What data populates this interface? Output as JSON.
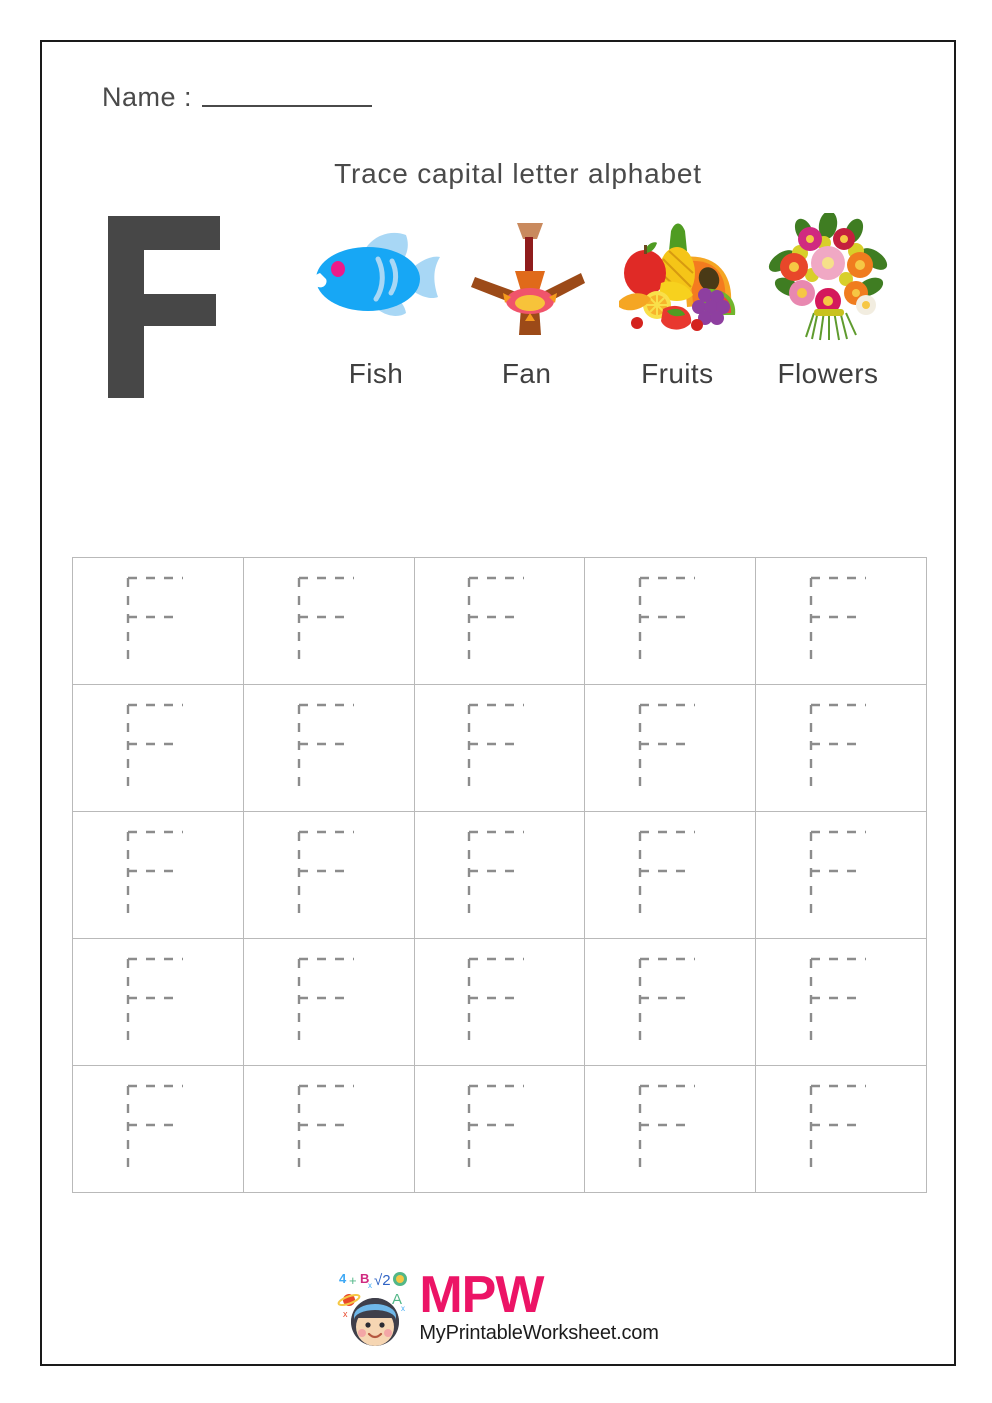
{
  "page": {
    "name_label": "Name :",
    "title": "Trace capital letter alphabet",
    "letter": "F",
    "letter_color": "#474747",
    "border_color": "#1a1a1a",
    "text_color": "#4a4a4a"
  },
  "pictures": [
    {
      "label": "Fish",
      "icon": "fish-illustration",
      "colors": [
        "#17a7f5",
        "#a8d7f5",
        "#ec1a8a"
      ]
    },
    {
      "label": "Fan",
      "icon": "ceiling-fan-illustration",
      "colors": [
        "#9c4a18",
        "#e06a1a",
        "#8f1c1c",
        "#f0546b"
      ]
    },
    {
      "label": "Fruits",
      "icon": "fruits-illustration",
      "colors": [
        "#e02a26",
        "#f5c518",
        "#71b52c",
        "#8e3fa0"
      ]
    },
    {
      "label": "Flowers",
      "icon": "flower-bouquet-illustration",
      "colors": [
        "#e8487e",
        "#f07c1e",
        "#d92a2a",
        "#4d8c2a"
      ]
    }
  ],
  "trace_grid": {
    "rows": 5,
    "columns": 5,
    "cell_count": 25,
    "trace_letter": "F",
    "dash_color": "#8c8c8c",
    "grid_line_color": "#b9b9b9",
    "cells": [
      "F",
      "F",
      "F",
      "F",
      "F",
      "F",
      "F",
      "F",
      "F",
      "F",
      "F",
      "F",
      "F",
      "F",
      "F",
      "F",
      "F",
      "F",
      "F",
      "F",
      "F",
      "F",
      "F",
      "F",
      "F"
    ]
  },
  "footer": {
    "brand": "MPW",
    "site": "MyPrintableWorksheet.com",
    "brand_color": "#ec1466",
    "mark_symbols": [
      "4",
      "+",
      "B",
      "√2",
      "A",
      "⊙"
    ]
  }
}
